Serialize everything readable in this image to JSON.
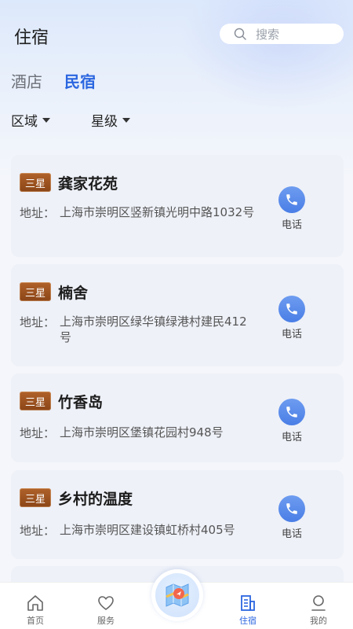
{
  "header": {
    "title": "住宿",
    "search_placeholder": "搜索"
  },
  "tabs": [
    {
      "label": "酒店",
      "active": false
    },
    {
      "label": "民宿",
      "active": true
    }
  ],
  "filters": [
    {
      "label": "区域"
    },
    {
      "label": "星级"
    }
  ],
  "listings": [
    {
      "badge": "三星",
      "name": "龚家花苑",
      "address_label": "地址：",
      "address": "上海市崇明区竖新镇光明中路1032号",
      "call_label": "电话"
    },
    {
      "badge": "三星",
      "name": "楠舍",
      "address_label": "地址：",
      "address": "上海市崇明区绿华镇绿港村建民412号",
      "call_label": "电话"
    },
    {
      "badge": "三星",
      "name": "竹香岛",
      "address_label": "地址：",
      "address": "上海市崇明区堡镇花园村948号",
      "call_label": "电话"
    },
    {
      "badge": "三星",
      "name": "乡村的温度",
      "address_label": "地址：",
      "address": "上海市崇明区建设镇虹桥村405号",
      "call_label": "电话"
    }
  ],
  "bottom_nav": [
    {
      "label": "首页",
      "icon": "home-icon",
      "active": false
    },
    {
      "label": "服务",
      "icon": "heart-icon",
      "active": false
    },
    {
      "label": "住宿",
      "icon": "building-icon",
      "active": true
    },
    {
      "label": "我的",
      "icon": "user-icon",
      "active": false
    }
  ],
  "colors": {
    "accent": "#2b66e0",
    "badge": "#9a4f1e",
    "card_bg": "#eef1f8"
  }
}
